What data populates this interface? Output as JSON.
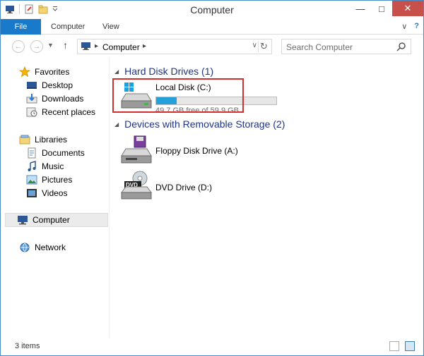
{
  "window": {
    "title": "Computer"
  },
  "ribbon": {
    "tabs": [
      {
        "label": "File"
      },
      {
        "label": "Computer"
      },
      {
        "label": "View"
      }
    ]
  },
  "address": {
    "location": "Computer",
    "search_placeholder": "Search Computer"
  },
  "sidebar": {
    "favorites": {
      "label": "Favorites",
      "items": [
        "Desktop",
        "Downloads",
        "Recent places"
      ]
    },
    "libraries": {
      "label": "Libraries",
      "items": [
        "Documents",
        "Music",
        "Pictures",
        "Videos"
      ]
    },
    "computer": "Computer",
    "network": "Network"
  },
  "content": {
    "groups": [
      {
        "header": "Hard Disk Drives (1)",
        "drives": [
          {
            "name": "Local Disk (C:)",
            "free_text": "49.7 GB free of 59.9 GB",
            "usage_fraction": 0.17
          }
        ]
      },
      {
        "header": "Devices with Removable Storage (2)",
        "drives": [
          {
            "name": "Floppy Disk Drive (A:)"
          },
          {
            "name": "DVD Drive (D:)"
          }
        ]
      }
    ]
  },
  "status": {
    "items": "3 items"
  },
  "colors": {
    "accent": "#1979ca",
    "group_header": "#1e3287",
    "progress": "#26a0da",
    "highlight_box": "#d42e2e"
  }
}
